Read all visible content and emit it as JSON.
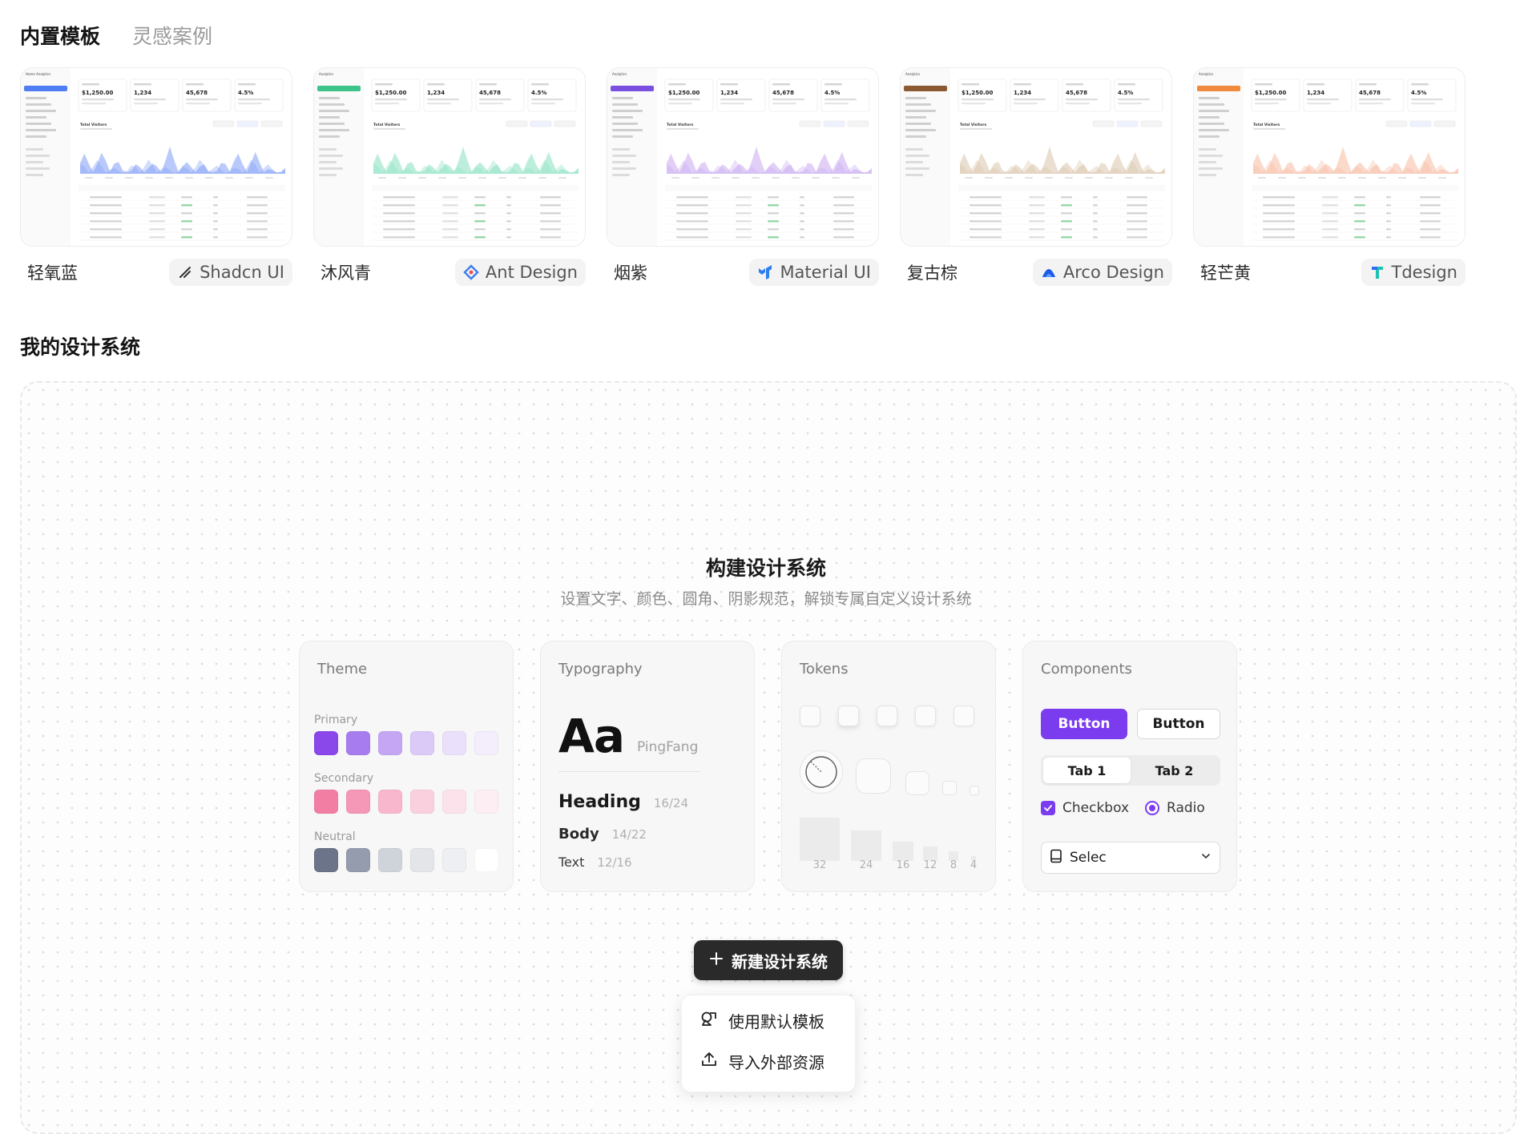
{
  "top_tabs": [
    {
      "label": "内置模板",
      "active": true
    },
    {
      "label": "灵感案例",
      "active": false
    }
  ],
  "templates": [
    {
      "name": "轻氧蓝",
      "badge": "Shadcn UI",
      "badge_icon": "shadcn-slash-icon",
      "accent": "#4f7df3",
      "chart_color": "#7f9cf5",
      "preview": {
        "nav_label": "Home Analytics",
        "stat1": "$1,250.00",
        "stat2": "1,234",
        "stat3": "45,678",
        "stat4": "4.5%",
        "chart_title": "Total Visitors"
      }
    },
    {
      "name": "沐风青",
      "badge": "Ant Design",
      "badge_icon": "ant-design-icon",
      "accent": "#3cc48a",
      "chart_color": "#86e0c0",
      "preview": {
        "nav_label": "Analytics",
        "stat1": "$1,250.00",
        "stat2": "1,234",
        "stat3": "45,678",
        "stat4": "4.5%",
        "chart_title": "Total Visitors"
      }
    },
    {
      "name": "烟紫",
      "badge": "Material UI",
      "badge_icon": "material-ui-icon",
      "accent": "#7b4fe0",
      "chart_color": "#c9a8f0",
      "preview": {
        "nav_label": "Analytics",
        "stat1": "$1,250.00",
        "stat2": "1,234",
        "stat3": "45,678",
        "stat4": "4.5%",
        "chart_title": "Total Visitors"
      }
    },
    {
      "name": "复古棕",
      "badge": "Arco Design",
      "badge_icon": "arco-design-icon",
      "accent": "#8c5a32",
      "chart_color": "#d9c4aa",
      "preview": {
        "nav_label": "Analytics",
        "stat1": "$1,250.00",
        "stat2": "1,234",
        "stat3": "45,678",
        "stat4": "4.5%",
        "chart_title": "Total Visitors"
      }
    },
    {
      "name": "轻芒黄",
      "badge": "Tdesign",
      "badge_icon": "tdesign-icon",
      "accent": "#f08a3c",
      "chart_color": "#f7b9a0",
      "preview": {
        "nav_label": "Analytics",
        "stat1": "$1,250.00",
        "stat2": "1,234",
        "stat3": "45,678",
        "stat4": "4.5%",
        "chart_title": "Total Visitors"
      }
    }
  ],
  "section_title": "我的设计系统",
  "hero": {
    "title": "构建设计系统",
    "subtitle": "设置文字、颜色、圆角、阴影规范，解锁专属自定义设计系统"
  },
  "theme_card": {
    "title": "Theme",
    "groups": [
      {
        "label": "Primary",
        "colors": [
          "#8a47ea",
          "#a77cef",
          "#c4a6f4",
          "#dbc9f8",
          "#ebe0fb",
          "#f4eefc"
        ]
      },
      {
        "label": "Secondary",
        "colors": [
          "#f27ea3",
          "#f597b6",
          "#f8b7cc",
          "#fad0de",
          "#fce2ea",
          "#fdeef3"
        ]
      },
      {
        "label": "Neutral",
        "colors": [
          "#6b7488",
          "#959cad",
          "#cfd3da",
          "#e3e5e9",
          "#eeeff2",
          "#ffffff"
        ]
      }
    ]
  },
  "typography_card": {
    "title": "Typography",
    "sample": "Aa",
    "font_name": "PingFang",
    "heading": {
      "label": "Heading",
      "meta": "16/24"
    },
    "body": {
      "label": "Body",
      "meta": "14/22"
    },
    "text": {
      "label": "Text",
      "meta": "12/16"
    }
  },
  "tokens_card": {
    "title": "Tokens",
    "scale": [
      "32",
      "24",
      "16",
      "12",
      "8",
      "4"
    ]
  },
  "components_card": {
    "title": "Components",
    "primary_button": "Button",
    "outline_button": "Button",
    "tabs": [
      {
        "label": "Tab 1",
        "active": true
      },
      {
        "label": "Tab 2",
        "active": false
      }
    ],
    "checkbox_label": "Checkbox",
    "checkbox_checked": true,
    "radio_label": "Radio",
    "radio_selected": true,
    "select_value": "Selec",
    "accent": "#7b3cf0"
  },
  "cta": {
    "label": "新建设计系统"
  },
  "dropdown": {
    "items": [
      {
        "label": "使用默认模板",
        "icon": "template-icon"
      },
      {
        "label": "导入外部资源",
        "icon": "upload-icon"
      }
    ]
  }
}
